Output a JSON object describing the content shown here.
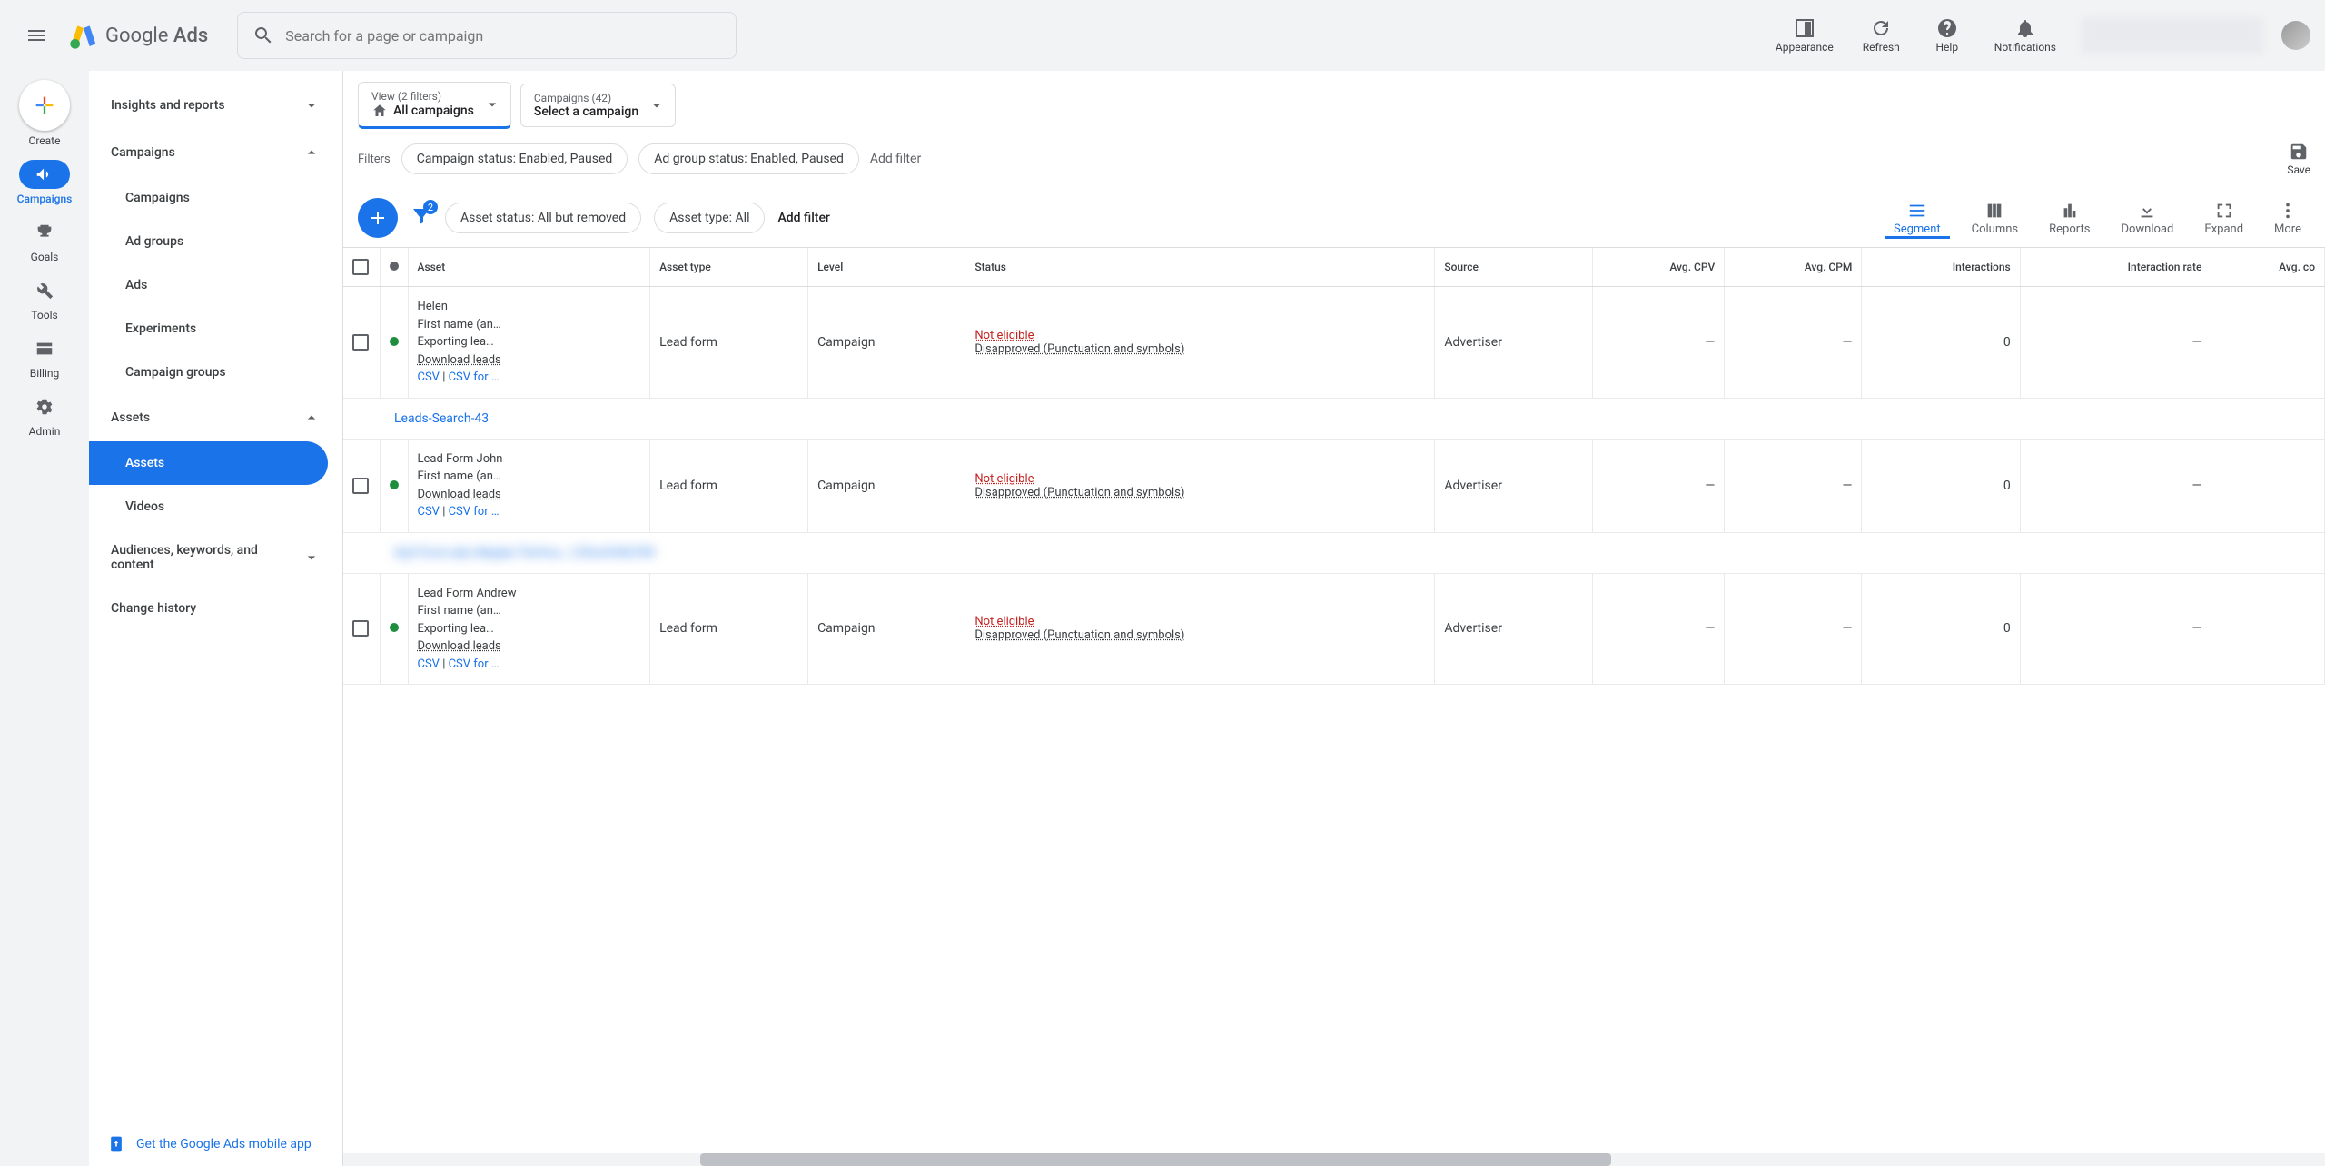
{
  "header": {
    "product_name": "Google",
    "product_suffix": "Ads",
    "search_placeholder": "Search for a page or campaign",
    "actions": {
      "appearance": "Appearance",
      "refresh": "Refresh",
      "help": "Help",
      "notifications": "Notifications"
    }
  },
  "rail": {
    "create": "Create",
    "campaigns": "Campaigns",
    "goals": "Goals",
    "tools": "Tools",
    "billing": "Billing",
    "admin": "Admin"
  },
  "sidebar": {
    "insights": "Insights and reports",
    "campaigns": "Campaigns",
    "campaigns_sub": "Campaigns",
    "ad_groups": "Ad groups",
    "ads": "Ads",
    "experiments": "Experiments",
    "campaign_groups": "Campaign groups",
    "assets": "Assets",
    "assets_sub": "Assets",
    "videos": "Videos",
    "audiences": "Audiences, keywords, and content",
    "change_history": "Change history",
    "mobile_app": "Get the Google Ads mobile app"
  },
  "scope": {
    "view_label": "View (2 filters)",
    "view_value": "All campaigns",
    "campaigns_label": "Campaigns (42)",
    "campaigns_value": "Select a campaign"
  },
  "filters": {
    "label": "Filters",
    "chip1": "Campaign status: Enabled, Paused",
    "chip2": "Ad group status: Enabled, Paused",
    "add": "Add filter",
    "save": "Save"
  },
  "toolbar": {
    "funnel_badge": "2",
    "chip_status": "Asset status: All but removed",
    "chip_type": "Asset type: All",
    "add_filter": "Add filter",
    "segment": "Segment",
    "columns": "Columns",
    "reports": "Reports",
    "download": "Download",
    "expand": "Expand",
    "more": "More"
  },
  "table": {
    "headers": {
      "asset": "Asset",
      "asset_type": "Asset type",
      "level": "Level",
      "status": "Status",
      "source": "Source",
      "avg_cpv": "Avg. CPV",
      "avg_cpm": "Avg. CPM",
      "interactions": "Interactions",
      "interaction_rate": "Interaction rate",
      "avg_cost": "Avg. co"
    },
    "groups": [
      {
        "name": "Leads-Search-43"
      },
      {
        "name_blurred": "XyZ-Form-abc-Maybe-TheYou-_1ZXorX456789"
      }
    ],
    "rows": [
      {
        "asset_title": "Helen",
        "asset_line2": "First name (an…",
        "asset_line3": "Exporting lea…",
        "download": "Download leads",
        "csv": "CSV",
        "csv_for": "CSV for …",
        "asset_type": "Lead form",
        "level": "Campaign",
        "status1": "Not eligible",
        "status2": "Disapproved (Punctuation and symbols)",
        "source": "Advertiser",
        "avg_cpv": "—",
        "avg_cpm": "—",
        "interactions": "0",
        "interaction_rate": "—"
      },
      {
        "asset_title": "Lead Form John",
        "asset_line2": "First name (an…",
        "asset_line3": "",
        "download": "Download leads",
        "csv": "CSV",
        "csv_for": "CSV for …",
        "asset_type": "Lead form",
        "level": "Campaign",
        "status1": "Not eligible",
        "status2": "Disapproved (Punctuation and symbols)",
        "source": "Advertiser",
        "avg_cpv": "—",
        "avg_cpm": "—",
        "interactions": "0",
        "interaction_rate": "—"
      },
      {
        "asset_title": "Lead Form Andrew",
        "asset_line2": "First name (an…",
        "asset_line3": "Exporting lea…",
        "download": "Download leads",
        "csv": "CSV",
        "csv_for": "CSV for …",
        "asset_type": "Lead form",
        "level": "Campaign",
        "status1": "Not eligible",
        "status2": "Disapproved (Punctuation and symbols)",
        "source": "Advertiser",
        "avg_cpv": "—",
        "avg_cpm": "—",
        "interactions": "0",
        "interaction_rate": "—"
      }
    ]
  }
}
